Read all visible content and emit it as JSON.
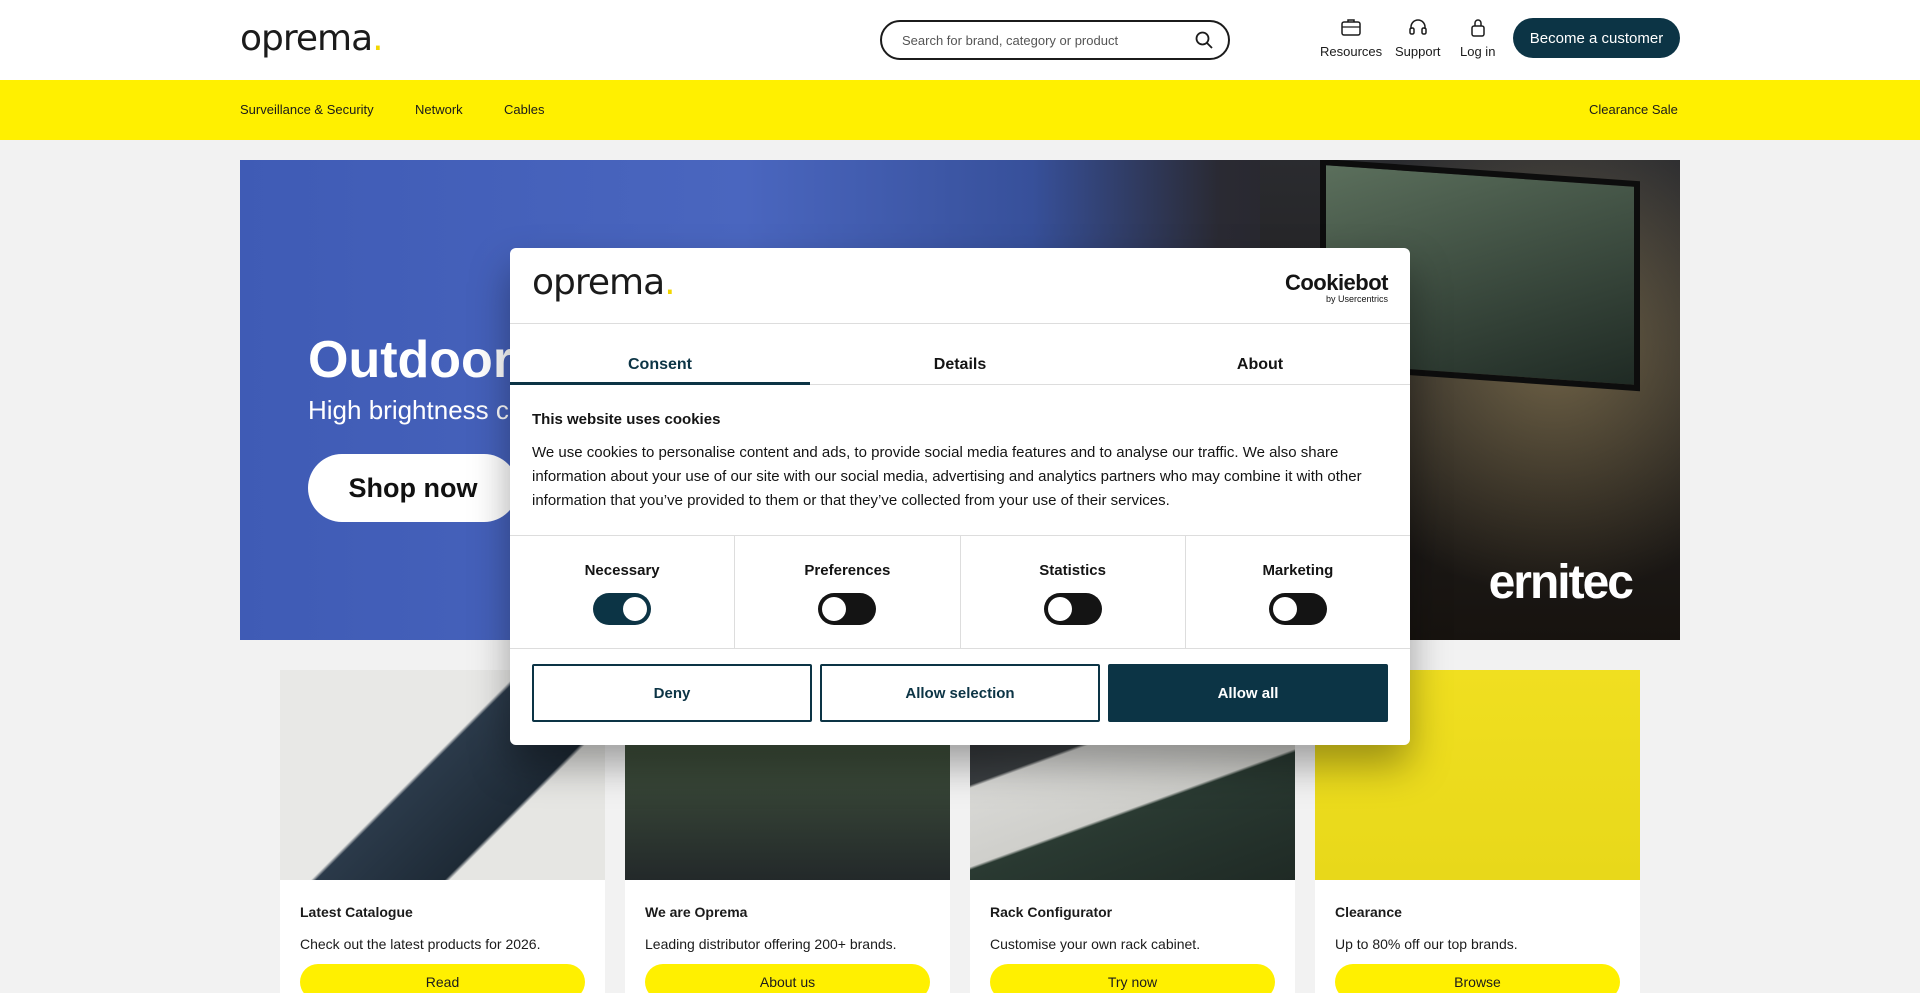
{
  "header": {
    "logo": "oprema",
    "logo_dot": ".",
    "search_placeholder": "Search for brand, category or product",
    "nav": [
      {
        "label": "Resources",
        "icon": "briefcase-icon"
      },
      {
        "label": "Support",
        "icon": "headset-icon"
      },
      {
        "label": "Log in",
        "icon": "lock-icon"
      }
    ],
    "cta": "Become a customer"
  },
  "categories": {
    "items": [
      "Surveillance & Security",
      "Network",
      "Cables"
    ],
    "right": "Clearance Sale"
  },
  "hero": {
    "title": "Outdoor",
    "subtitle": "High brightness c",
    "button": "Shop now",
    "brand": "ernitec"
  },
  "cards": [
    {
      "title": "Latest Catalogue",
      "text": "Check out the latest products for 2026.",
      "button": "Read"
    },
    {
      "title": "We are Oprema",
      "text": "Leading distributor offering 200+ brands.",
      "button": "About us"
    },
    {
      "title": "Rack Configurator",
      "text": "Customise your own rack cabinet.",
      "button": "Try now"
    },
    {
      "title": "Clearance",
      "text": "Up to 80% off our top brands.",
      "button": "Browse"
    }
  ],
  "cookie": {
    "logo": "oprema",
    "logo_dot": ".",
    "cookiebot": "Cookiebot",
    "cookiebot_by": "by Usercentrics",
    "tabs": [
      "Consent",
      "Details",
      "About"
    ],
    "heading": "This website uses cookies",
    "text": "We use cookies to personalise content and ads, to provide social media features and to analyse our traffic. We also share information about your use of our site with our social media, advertising and analytics partners who may combine it with other information that you’ve provided to them or that they’ve collected from your use of their services.",
    "toggles": [
      {
        "label": "Necessary",
        "on": true
      },
      {
        "label": "Preferences",
        "on": false
      },
      {
        "label": "Statistics",
        "on": false
      },
      {
        "label": "Marketing",
        "on": false
      }
    ],
    "buttons": {
      "deny": "Deny",
      "selection": "Allow selection",
      "all": "Allow all"
    }
  },
  "colors": {
    "accent_yellow": "#fff000",
    "brand_dark": "#0c3445"
  }
}
